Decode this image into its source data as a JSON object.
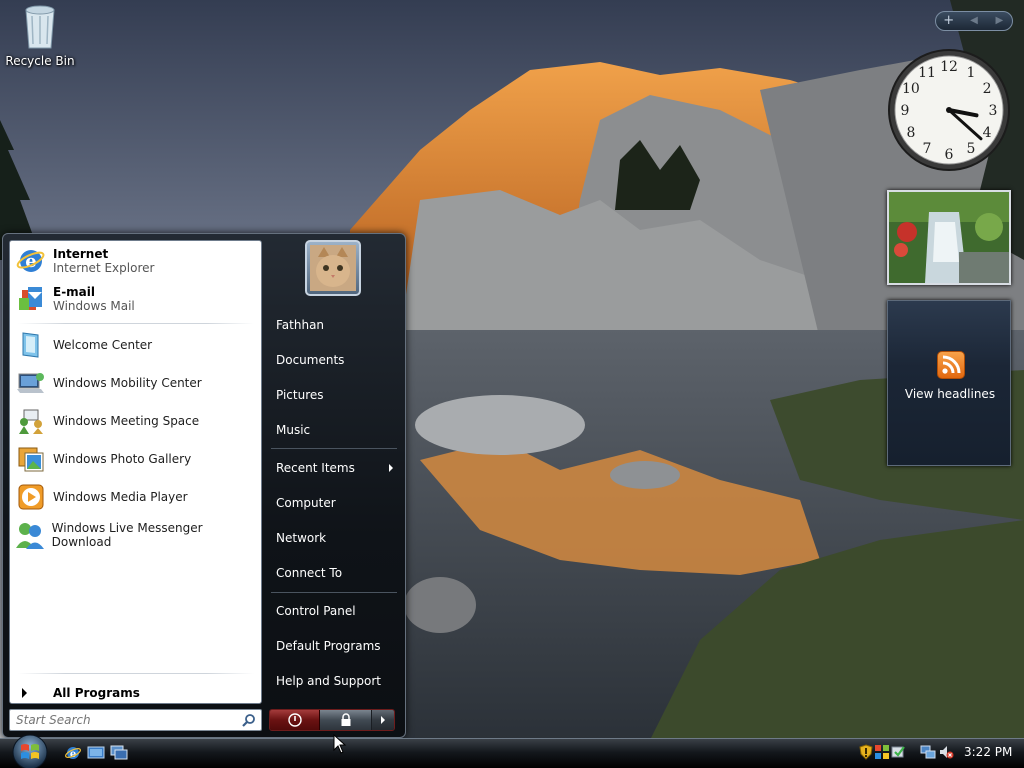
{
  "desktop": {
    "recycle_bin_label": "Recycle Bin"
  },
  "gadgets": {
    "toolbar": {
      "add_glyph": "+",
      "prev_glyph": "◀",
      "next_glyph": "▶"
    },
    "clock": {
      "hour": 3,
      "minute": 22,
      "numbers": [
        "12",
        "1",
        "2",
        "3",
        "4",
        "5",
        "6",
        "7",
        "8",
        "9",
        "10",
        "11"
      ]
    },
    "feed_headlines_label": "View headlines"
  },
  "start_menu": {
    "pinned": [
      {
        "title": "Internet",
        "subtitle": "Internet Explorer",
        "icon": "internet-explorer-icon"
      },
      {
        "title": "E-mail",
        "subtitle": "Windows Mail",
        "icon": "windows-mail-icon"
      }
    ],
    "recent_programs": [
      {
        "label": "Welcome Center",
        "icon": "welcome-center-icon"
      },
      {
        "label": "Windows Mobility Center",
        "icon": "mobility-center-icon"
      },
      {
        "label": "Windows Meeting Space",
        "icon": "meeting-space-icon"
      },
      {
        "label": "Windows Photo Gallery",
        "icon": "photo-gallery-icon"
      },
      {
        "label": "Windows Media Player",
        "icon": "media-player-icon"
      },
      {
        "label": "Windows Live Messenger Download",
        "icon": "messenger-icon"
      }
    ],
    "all_programs_label": "All Programs",
    "search_placeholder": "Start Search",
    "right_pane": {
      "user_name": "Fathhan",
      "items_group1": [
        "Documents",
        "Pictures",
        "Music"
      ],
      "items_group2": [
        "Recent Items",
        "Computer",
        "Network",
        "Connect To"
      ],
      "items_group3": [
        "Control Panel",
        "Default Programs",
        "Help and Support"
      ]
    }
  },
  "taskbar": {
    "quick_launch": [
      "internet-explorer-icon",
      "show-desktop-icon",
      "switch-windows-icon"
    ],
    "tray_icons": [
      "security-shield-icon",
      "windows-defender-icon",
      "sync-check-icon",
      "network-icon",
      "volume-muted-icon"
    ],
    "clock": "3:22 PM"
  },
  "colors": {
    "power_button": "#8b1f1f",
    "rss_orange": "#ee7d1e",
    "menu_dark": "#0f1318"
  }
}
